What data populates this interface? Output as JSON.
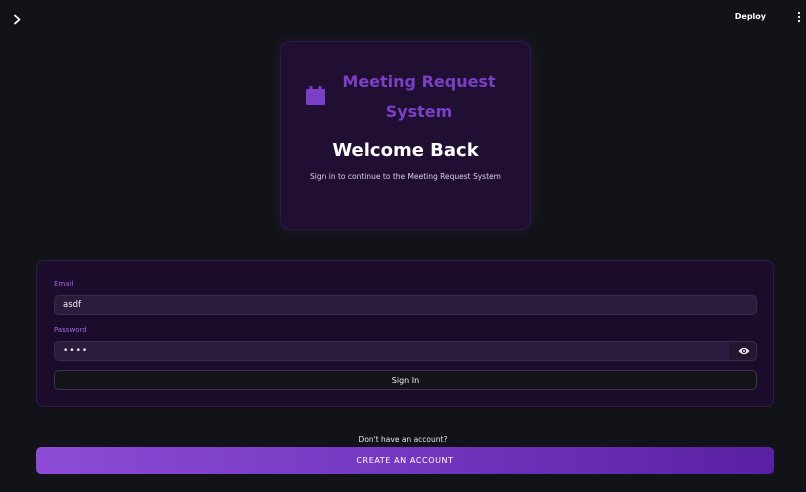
{
  "topbar": {
    "deploy_label": "Deploy"
  },
  "hero": {
    "icon": "calendar-icon",
    "title": "Meeting Request System",
    "welcome": "Welcome Back",
    "subtitle": "Sign in to continue to the Meeting Request System"
  },
  "form": {
    "email_label": "Email",
    "email_value": "asdf",
    "password_label": "Password",
    "password_masked": "••••",
    "signin_label": "Sign In"
  },
  "signup": {
    "prompt": "Don't have an account?",
    "create_label": "CREATE AN ACCOUNT"
  },
  "colors": {
    "accent": "#7a3fc4",
    "label": "#a761e0",
    "background": "#121318",
    "card": "#200f33"
  }
}
